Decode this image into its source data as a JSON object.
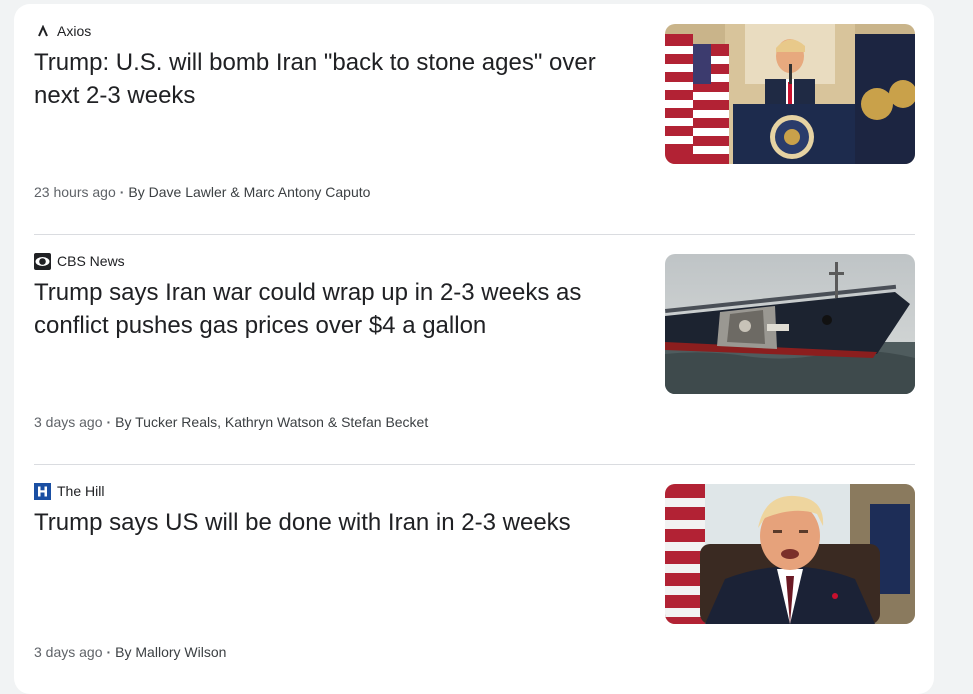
{
  "articles": [
    {
      "source": "Axios",
      "source_icon": "axios-logo",
      "headline": "Trump: U.S. will bomb Iran \"back to stone ages\" over next 2-3 weeks",
      "time": "23 hours ago",
      "byline": "By Dave Lawler & Marc Antony Caputo",
      "thumbnail": "trump-at-presidential-podium-photo"
    },
    {
      "source": "CBS News",
      "source_icon": "cbs-eye-logo",
      "headline": "Trump says Iran war could wrap up in 2-3 weeks as conflict pushes gas prices over $4 a gallon",
      "time": "3 days ago",
      "byline": "By Tucker Reals, Kathryn Watson & Stefan Becket",
      "thumbnail": "damaged-tanker-ship-photo"
    },
    {
      "source": "The Hill",
      "source_icon": "the-hill-logo",
      "headline": "Trump says US will be done with Iran in 2-3 weeks",
      "time": "3 days ago",
      "byline": "By Mallory Wilson",
      "thumbnail": "trump-speaking-portrait-photo"
    }
  ],
  "colors": {
    "headline": "#202124",
    "meta": "#5f6368",
    "divider": "#dadce0",
    "hill_blue": "#1a4fa3"
  }
}
